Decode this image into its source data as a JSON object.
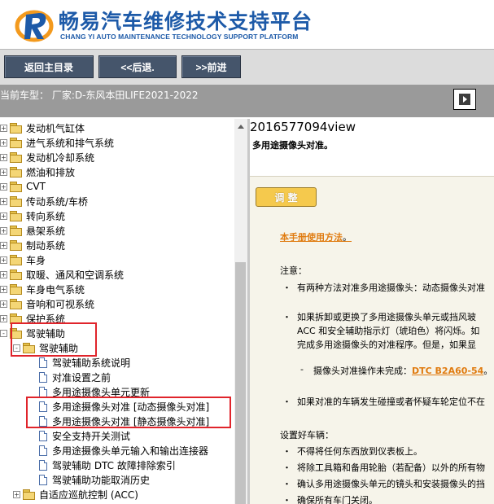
{
  "header": {
    "title_cn": "畅易汽车维修技术支持平台",
    "title_en": "CHANG YI AUTO MAINTENANCE TECHNOLOGY SUPPORT PLATFORM",
    "colors": {
      "brand_blue": "#1d5aa8",
      "logo_orange": "#f39a1e"
    }
  },
  "toolbar": {
    "back_main": "返回主目录",
    "back": "<<后退.",
    "forward": ">>前进"
  },
  "model": {
    "text": "当前车型： 厂家:D-东风本田LIFE2021-2022"
  },
  "tree": {
    "items": [
      {
        "label": "发动机气缸体",
        "type": "folder",
        "expander": "+"
      },
      {
        "label": "进气系统和排气系统",
        "type": "folder",
        "expander": "+"
      },
      {
        "label": "发动机冷却系统",
        "type": "folder",
        "expander": "+"
      },
      {
        "label": "燃油和排放",
        "type": "folder",
        "expander": "+"
      },
      {
        "label": "CVT",
        "type": "folder",
        "expander": "+"
      },
      {
        "label": "传动系统/车桥",
        "type": "folder",
        "expander": "+"
      },
      {
        "label": "转向系统",
        "type": "folder",
        "expander": "+"
      },
      {
        "label": "悬架系统",
        "type": "folder",
        "expander": "+"
      },
      {
        "label": "制动系统",
        "type": "folder",
        "expander": "+"
      },
      {
        "label": "车身",
        "type": "folder",
        "expander": "+"
      },
      {
        "label": "取暖、通风和空调系统",
        "type": "folder",
        "expander": "+"
      },
      {
        "label": "车身电气系统",
        "type": "folder",
        "expander": "+"
      },
      {
        "label": "音响和可视系统",
        "type": "folder",
        "expander": "+"
      },
      {
        "label": "保护系统",
        "type": "folder",
        "expander": "+"
      },
      {
        "label": "驾驶辅助",
        "type": "folder",
        "expander": "-"
      },
      {
        "label": "驾驶辅助",
        "type": "folder",
        "expander": "-"
      },
      {
        "label": "驾驶辅助系统说明",
        "type": "doc"
      },
      {
        "label": "对准设置之前",
        "type": "doc"
      },
      {
        "label": "多用途摄像头单元更新",
        "type": "doc"
      },
      {
        "label": "多用途摄像头对准 [动态摄像头对准]",
        "type": "doc"
      },
      {
        "label": "多用途摄像头对准 [静态摄像头对准]",
        "type": "doc"
      },
      {
        "label": "安全支持开关测试",
        "type": "doc"
      },
      {
        "label": "多用途摄像头单元输入和输出连接器",
        "type": "doc"
      },
      {
        "label": "驾驶辅助 DTC 故障排除索引",
        "type": "doc"
      },
      {
        "label": "驾驶辅助功能取消历史",
        "type": "doc"
      },
      {
        "label": "自适应巡航控制 (ACC)",
        "type": "folder",
        "expander": "+"
      }
    ]
  },
  "content": {
    "doc_id": "2016577094view",
    "doc_title": "多用途摄像头对准。",
    "adjust_button": "调 整",
    "manual_link": "本手册使用方法",
    "manual_link_suffix": "。",
    "notes_heading": "注意：",
    "note1": "有两种方法对准多用途摄像头：动态摄像头对准",
    "note2_line1": "如果拆卸或更换了多用途摄像头单元或挡风玻",
    "note2_line2": "ACC 和安全辅助指示灯（琥珀色）将闪烁。如",
    "note2_line3": "完成多用途摄像头的对准程序。但是，如果显",
    "subnote_prefix": "摄像头对准操作未完成：",
    "dtc_link": "DTC B2A60-54",
    "subnote_suffix": "。",
    "note3": "如果对准的车辆发生碰撞或者怀疑车轮定位不在",
    "setup_heading": "设置好车辆：",
    "setup1": "不得将任何东西放到仪表板上。",
    "setup2": "将除工具箱和备用轮胎（若配备）以外的所有物",
    "setup3": "确认多用途摄像头单元的镜头和安装摄像头的挡",
    "setup4": "确保所有车门关闭。",
    "colors": {
      "link_orange": "#e07b10",
      "button_yellow": "#f5c94d"
    }
  }
}
